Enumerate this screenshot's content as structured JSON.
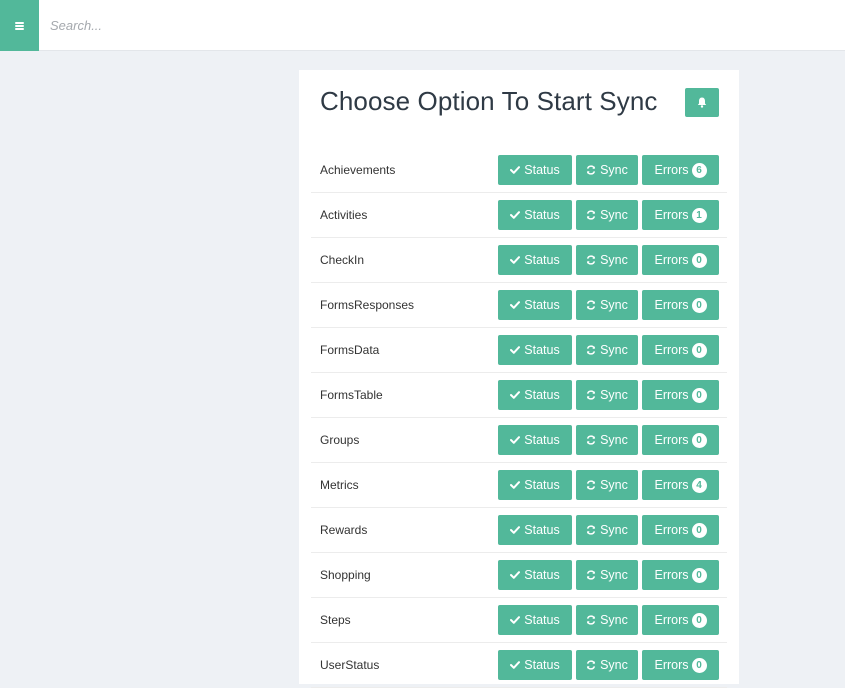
{
  "header": {
    "menu_icon": "hamburger-icon",
    "search_placeholder": "Search..."
  },
  "panel": {
    "title": "Choose Option To Start Sync",
    "bell_icon": "bell-icon"
  },
  "buttons": {
    "status_label": "Status",
    "sync_label": "Sync",
    "errors_label": "Errors"
  },
  "rows": [
    {
      "label": "Achievements",
      "errors": "6"
    },
    {
      "label": "Activities",
      "errors": "1"
    },
    {
      "label": "CheckIn",
      "errors": "0"
    },
    {
      "label": "FormsResponses",
      "errors": "0"
    },
    {
      "label": "FormsData",
      "errors": "0"
    },
    {
      "label": "FormsTable",
      "errors": "0"
    },
    {
      "label": "Groups",
      "errors": "0"
    },
    {
      "label": "Metrics",
      "errors": "4"
    },
    {
      "label": "Rewards",
      "errors": "0"
    },
    {
      "label": "Shopping",
      "errors": "0"
    },
    {
      "label": "Steps",
      "errors": "0"
    },
    {
      "label": "UserStatus",
      "errors": "0"
    }
  ],
  "colors": {
    "accent": "#52b89a",
    "background": "#eef1f5"
  }
}
